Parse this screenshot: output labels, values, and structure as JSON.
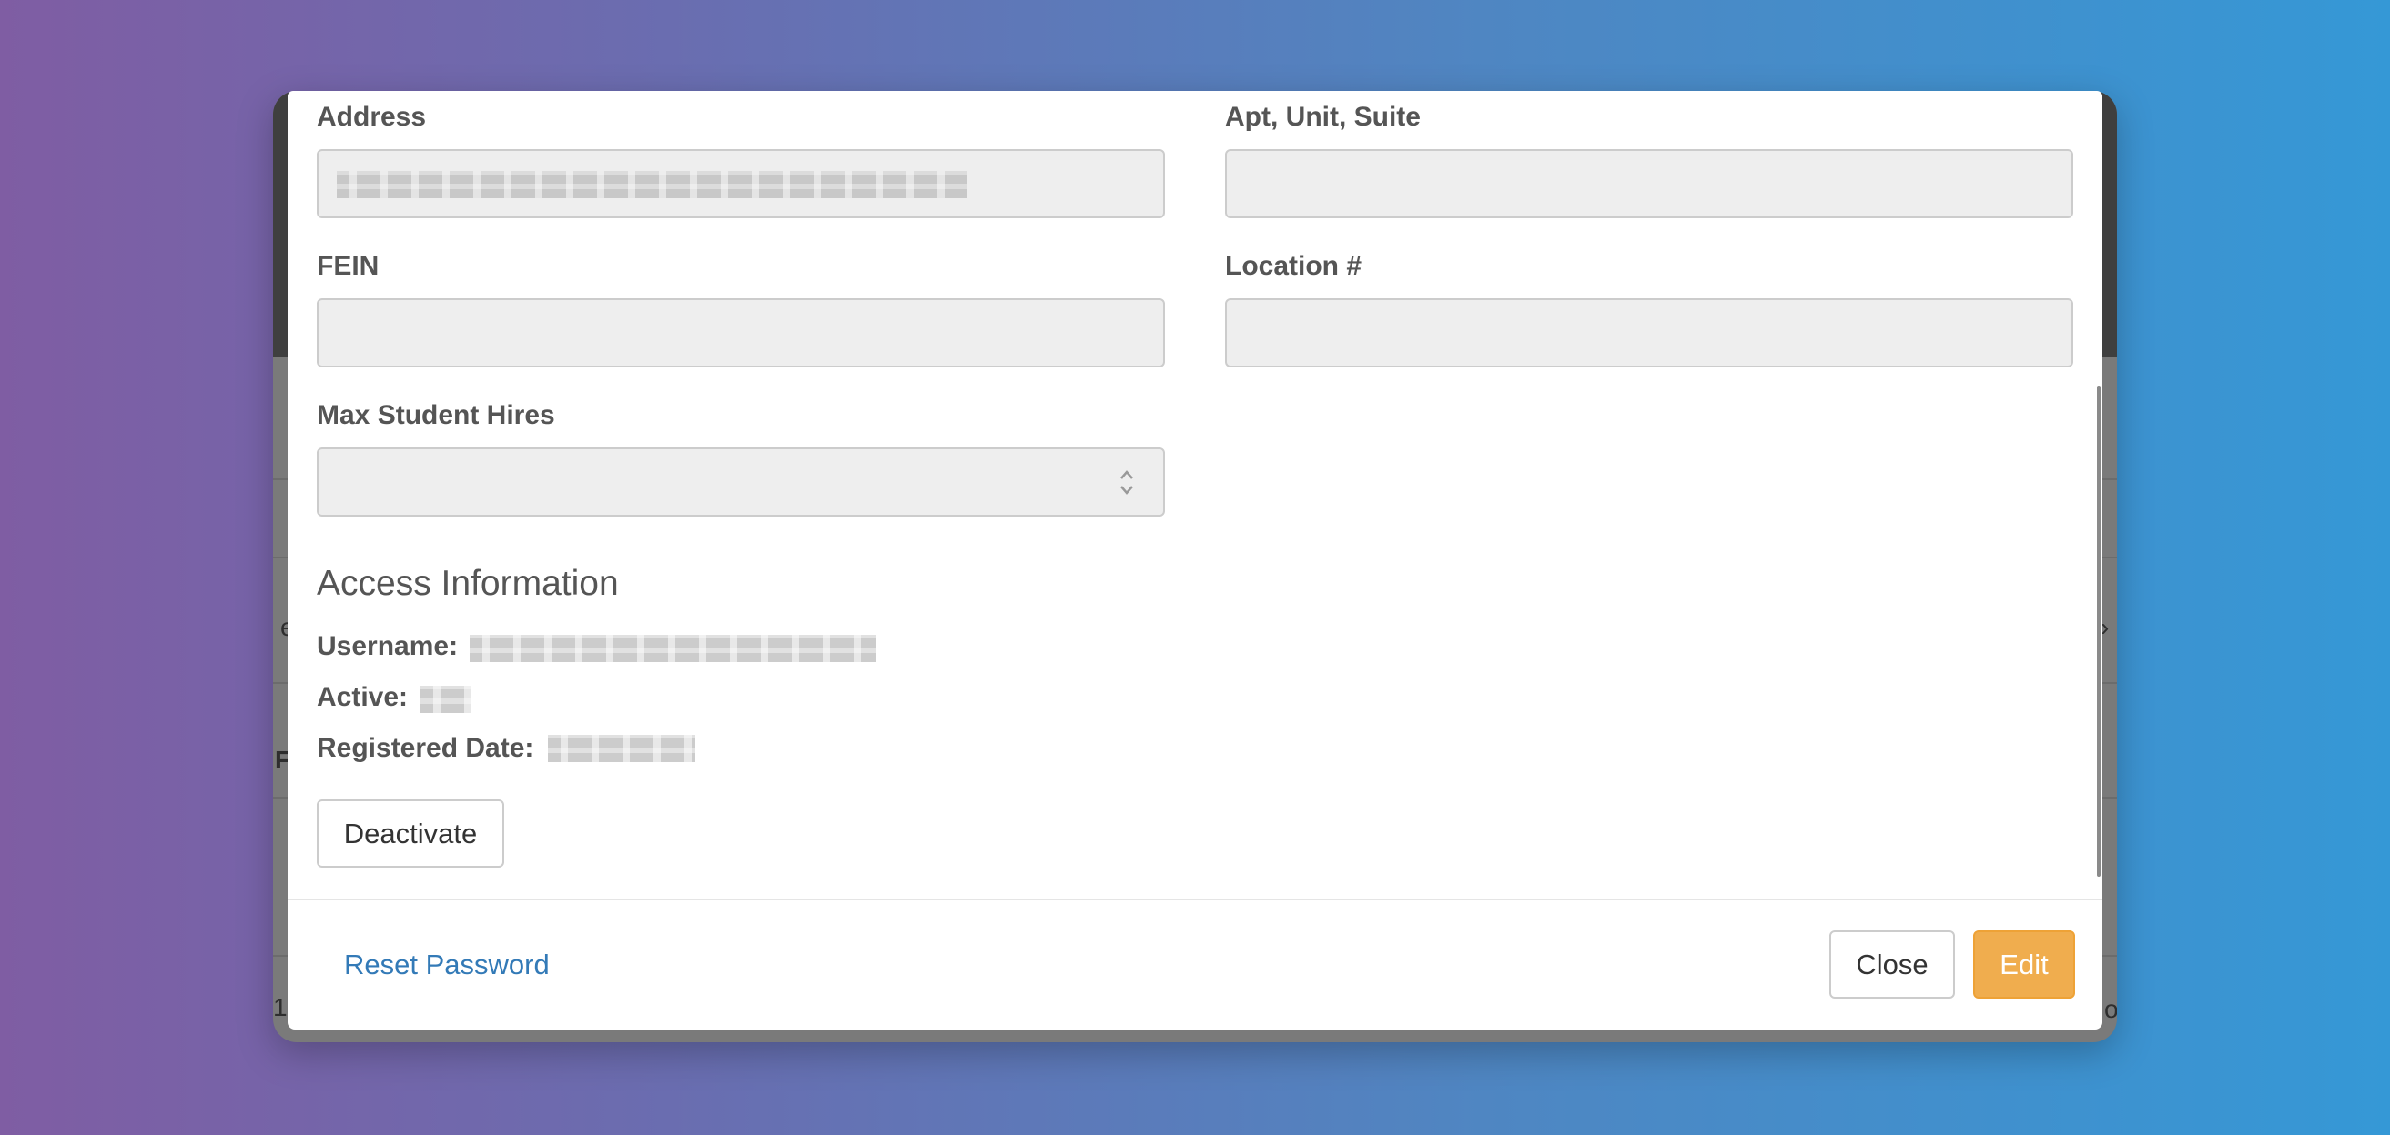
{
  "background_window": {
    "fragments": [
      "e",
      "F",
      "1",
      "›",
      "o"
    ]
  },
  "modal": {
    "fields": {
      "address": {
        "label": "Address",
        "value": ""
      },
      "apt": {
        "label": "Apt, Unit, Suite",
        "value": ""
      },
      "fein": {
        "label": "FEIN",
        "value": ""
      },
      "location": {
        "label": "Location #",
        "value": ""
      },
      "max_hires": {
        "label": "Max Student Hires",
        "value": ""
      }
    },
    "access": {
      "title": "Access Information",
      "username_label": "Username:",
      "active_label": "Active:",
      "registered_label": "Registered Date:"
    },
    "deactivate_label": "Deactivate",
    "footer": {
      "reset_password_label": "Reset Password",
      "close_label": "Close",
      "edit_label": "Edit"
    }
  },
  "colors": {
    "label": "#555555",
    "input_bg": "#eeeeee",
    "link": "#337ab7",
    "edit_button": "#f0ad4e"
  },
  "icons": {
    "stepper": "chevron-up-down-icon"
  }
}
